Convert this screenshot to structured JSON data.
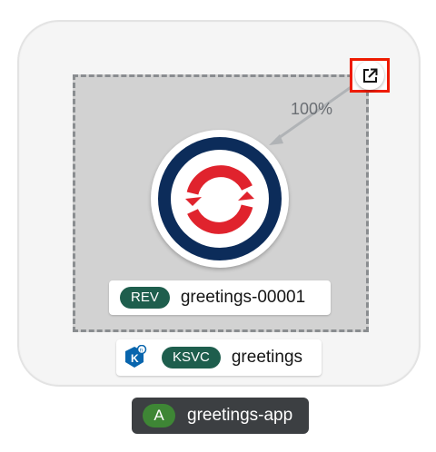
{
  "application": {
    "badge": "A",
    "name": "greetings-app",
    "badge_color": "#3e8635"
  },
  "knative_service": {
    "badge": "KSVC",
    "name": "greetings",
    "icon": "knative-icon",
    "badge_color": "#1e5e4d"
  },
  "revision": {
    "badge": "REV",
    "name": "greetings-00001",
    "icon": "openshift-icon",
    "badge_color": "#1e5e4d"
  },
  "traffic": {
    "percent_label": "100%"
  },
  "actions": {
    "open_url_icon": "external-link-icon",
    "highlight_color": "#ee1b00"
  }
}
